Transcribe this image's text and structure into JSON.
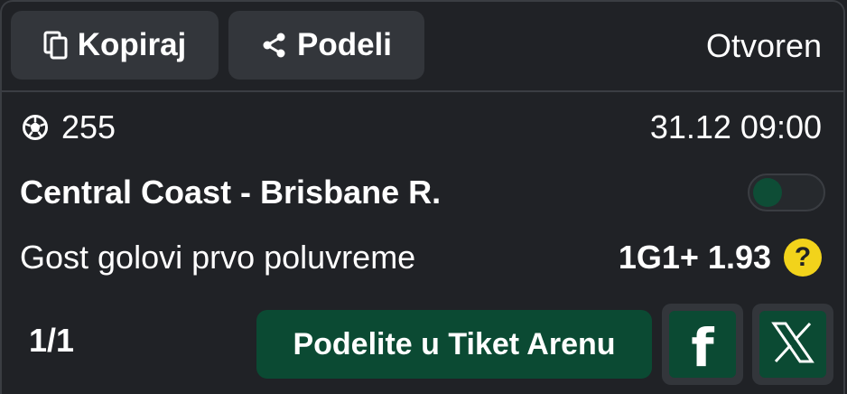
{
  "toolbar": {
    "copy_label": "Kopiraj",
    "share_label": "Podeli",
    "status": "Otvoren"
  },
  "event": {
    "id": "255",
    "datetime": "31.12 09:00",
    "match": "Central Coast - Brisbane R.",
    "market": "Gost golovi prvo poluvreme",
    "odds": "1G1+ 1.93",
    "help": "?"
  },
  "footer": {
    "page": "1/1",
    "arena_button": "Podelite u Tiket Arenu"
  },
  "icons": {
    "copy": "copy-icon",
    "share": "share-icon",
    "sport": "soccer-ball-icon",
    "facebook": "facebook-icon",
    "x": "x-icon"
  },
  "colors": {
    "background": "#202226",
    "button": "#33363b",
    "accent_green": "#0b4a33",
    "help_yellow": "#f2d31b"
  }
}
